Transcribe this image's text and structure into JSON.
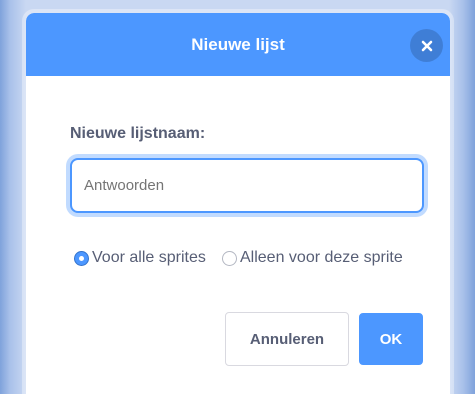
{
  "colors": {
    "accent": "#4C97FF",
    "text": "#575E75",
    "backdrop": "#C9D8F2"
  },
  "dialog": {
    "title": "Nieuwe lijst",
    "close_icon": "close-icon",
    "field_label": "Nieuwe lijstnaam:",
    "input": {
      "value": "",
      "placeholder": "Antwoorden"
    },
    "scope_options": [
      {
        "label": "Voor alle sprites",
        "checked": true
      },
      {
        "label": "Alleen voor deze sprite",
        "checked": false
      }
    ],
    "buttons": {
      "cancel_label": "Annuleren",
      "ok_label": "OK"
    }
  }
}
